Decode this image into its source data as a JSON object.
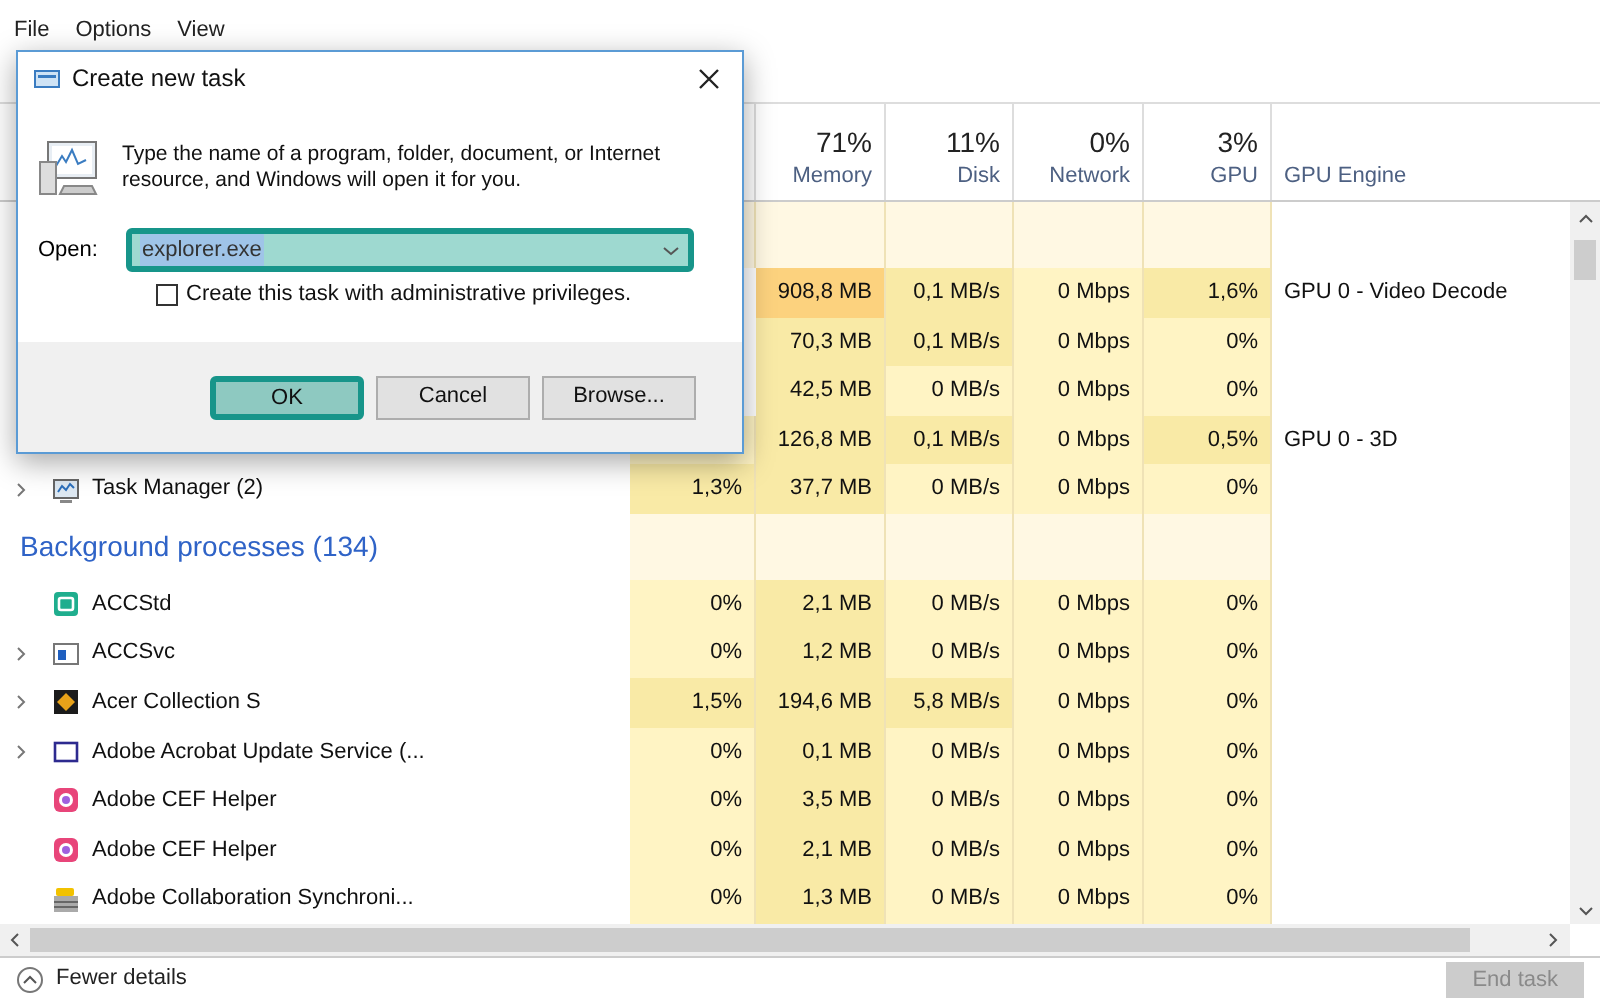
{
  "menu": [
    {
      "label": "File"
    },
    {
      "label": "Options"
    },
    {
      "label": "View"
    }
  ],
  "columns": [
    {
      "label": "Memory",
      "percent": "71%"
    },
    {
      "label": "Disk",
      "percent": "11%"
    },
    {
      "label": "Network",
      "percent": "0%"
    },
    {
      "label": "GPU",
      "percent": "3%"
    },
    {
      "label": "GPU Engine"
    }
  ],
  "rows": [
    {
      "kind": "group"
    },
    {
      "kind": "process",
      "expandable": false,
      "cells": [
        null,
        {
          "text": "908,8 MB",
          "color": "#fcd27e"
        },
        {
          "text": "0,1 MB/s",
          "color": "#f9eaa6"
        },
        {
          "text": "0 Mbps",
          "color": "#fff4c4"
        },
        {
          "text": "1,6%",
          "color": "#f9eaa6"
        }
      ],
      "engine": "GPU 0 - Video Decode"
    },
    {
      "kind": "process",
      "expandable": false,
      "cells": [
        null,
        {
          "text": "70,3 MB",
          "color": "#f9eaa6"
        },
        {
          "text": "0,1 MB/s",
          "color": "#f9eaa6"
        },
        {
          "text": "0 Mbps",
          "color": "#fff4c4"
        },
        {
          "text": "0%",
          "color": "#fff4c4"
        }
      ]
    },
    {
      "kind": "process",
      "expandable": false,
      "cells": [
        null,
        {
          "text": "42,5 MB",
          "color": "#f9eaa6"
        },
        {
          "text": "0 MB/s",
          "color": "#fff4c4"
        },
        {
          "text": "0 Mbps",
          "color": "#fff4c4"
        },
        {
          "text": "0%",
          "color": "#fff4c4"
        }
      ]
    },
    {
      "kind": "process",
      "expandable": false,
      "cells": [
        {
          "color": "#fff4c4"
        },
        {
          "text": "126,8 MB",
          "color": "#f9eaa6"
        },
        {
          "text": "0,1 MB/s",
          "color": "#f9eaa6"
        },
        {
          "text": "0 Mbps",
          "color": "#fff4c4"
        },
        {
          "text": "0,5%",
          "color": "#f9eaa6"
        }
      ],
      "engine": "GPU 0 - 3D"
    },
    {
      "kind": "process",
      "name": "Task Manager (2)",
      "expandable": true,
      "cells": [
        {
          "text": "1,3%",
          "color": "#f9eaa6"
        },
        {
          "text": "37,7 MB",
          "color": "#f9eaa6"
        },
        {
          "text": "0 MB/s",
          "color": "#fff4c4"
        },
        {
          "text": "0 Mbps",
          "color": "#fff4c4"
        },
        {
          "text": "0%",
          "color": "#fff4c4"
        }
      ]
    },
    {
      "kind": "group",
      "label": "Background processes (134)"
    },
    {
      "kind": "process",
      "name": "ACCStd",
      "expandable": false,
      "cells": [
        {
          "text": "0%",
          "color": "#fff4c4"
        },
        {
          "text": "2,1 MB",
          "color": "#f9eaa6"
        },
        {
          "text": "0 MB/s",
          "color": "#fff4c4"
        },
        {
          "text": "0 Mbps",
          "color": "#fff4c4"
        },
        {
          "text": "0%",
          "color": "#fff4c4"
        }
      ]
    },
    {
      "kind": "process",
      "name": "ACCSvc",
      "expandable": true,
      "cells": [
        {
          "text": "0%",
          "color": "#fff4c4"
        },
        {
          "text": "1,2 MB",
          "color": "#f9eaa6"
        },
        {
          "text": "0 MB/s",
          "color": "#fff4c4"
        },
        {
          "text": "0 Mbps",
          "color": "#fff4c4"
        },
        {
          "text": "0%",
          "color": "#fff4c4"
        }
      ]
    },
    {
      "kind": "process",
      "name": "Acer Collection S",
      "expandable": true,
      "cells": [
        {
          "text": "1,5%",
          "color": "#f9eaa6"
        },
        {
          "text": "194,6 MB",
          "color": "#f9eaa6"
        },
        {
          "text": "5,8 MB/s",
          "color": "#f9eaa6"
        },
        {
          "text": "0 Mbps",
          "color": "#fff4c4"
        },
        {
          "text": "0%",
          "color": "#fff4c4"
        }
      ]
    },
    {
      "kind": "process",
      "name": "Adobe Acrobat Update Service (...",
      "expandable": true,
      "cells": [
        {
          "text": "0%",
          "color": "#fff4c4"
        },
        {
          "text": "0,1 MB",
          "color": "#f9eaa6"
        },
        {
          "text": "0 MB/s",
          "color": "#fff4c4"
        },
        {
          "text": "0 Mbps",
          "color": "#fff4c4"
        },
        {
          "text": "0%",
          "color": "#fff4c4"
        }
      ]
    },
    {
      "kind": "process",
      "name": "Adobe CEF Helper",
      "expandable": false,
      "cells": [
        {
          "text": "0%",
          "color": "#fff4c4"
        },
        {
          "text": "3,5 MB",
          "color": "#f9eaa6"
        },
        {
          "text": "0 MB/s",
          "color": "#fff4c4"
        },
        {
          "text": "0 Mbps",
          "color": "#fff4c4"
        },
        {
          "text": "0%",
          "color": "#fff4c4"
        }
      ]
    },
    {
      "kind": "process",
      "name": "Adobe CEF Helper",
      "expandable": false,
      "cells": [
        {
          "text": "0%",
          "color": "#fff4c4"
        },
        {
          "text": "2,1 MB",
          "color": "#f9eaa6"
        },
        {
          "text": "0 MB/s",
          "color": "#fff4c4"
        },
        {
          "text": "0 Mbps",
          "color": "#fff4c4"
        },
        {
          "text": "0%",
          "color": "#fff4c4"
        }
      ]
    },
    {
      "kind": "process",
      "name": "Adobe Collaboration Synchroni...",
      "expandable": false,
      "cells": [
        {
          "text": "0%",
          "color": "#fff4c4"
        },
        {
          "text": "1,3 MB",
          "color": "#f9eaa6"
        },
        {
          "text": "0 MB/s",
          "color": "#fff4c4"
        },
        {
          "text": "0 Mbps",
          "color": "#fff4c4"
        },
        {
          "text": "0%",
          "color": "#fff4c4"
        }
      ]
    }
  ],
  "footer": {
    "fewer_details": "Fewer details",
    "end_task": {
      "label": "End task",
      "disabled": true
    }
  },
  "dialog": {
    "title": "Create new task",
    "message": "Type the name of a program, folder, document, or Internet resource, and Windows will open it for you.",
    "open_label": "Open:",
    "open_field": {
      "value": "explorer.exe",
      "highlighted": true
    },
    "admin_checkbox": {
      "label": "Create this task with administrative privileges.",
      "checked": false
    },
    "buttons": [
      {
        "label": "OK",
        "highlighted": true
      },
      {
        "label": "Cancel",
        "highlighted": false
      },
      {
        "label": "Browse...",
        "highlighted": false
      }
    ]
  }
}
